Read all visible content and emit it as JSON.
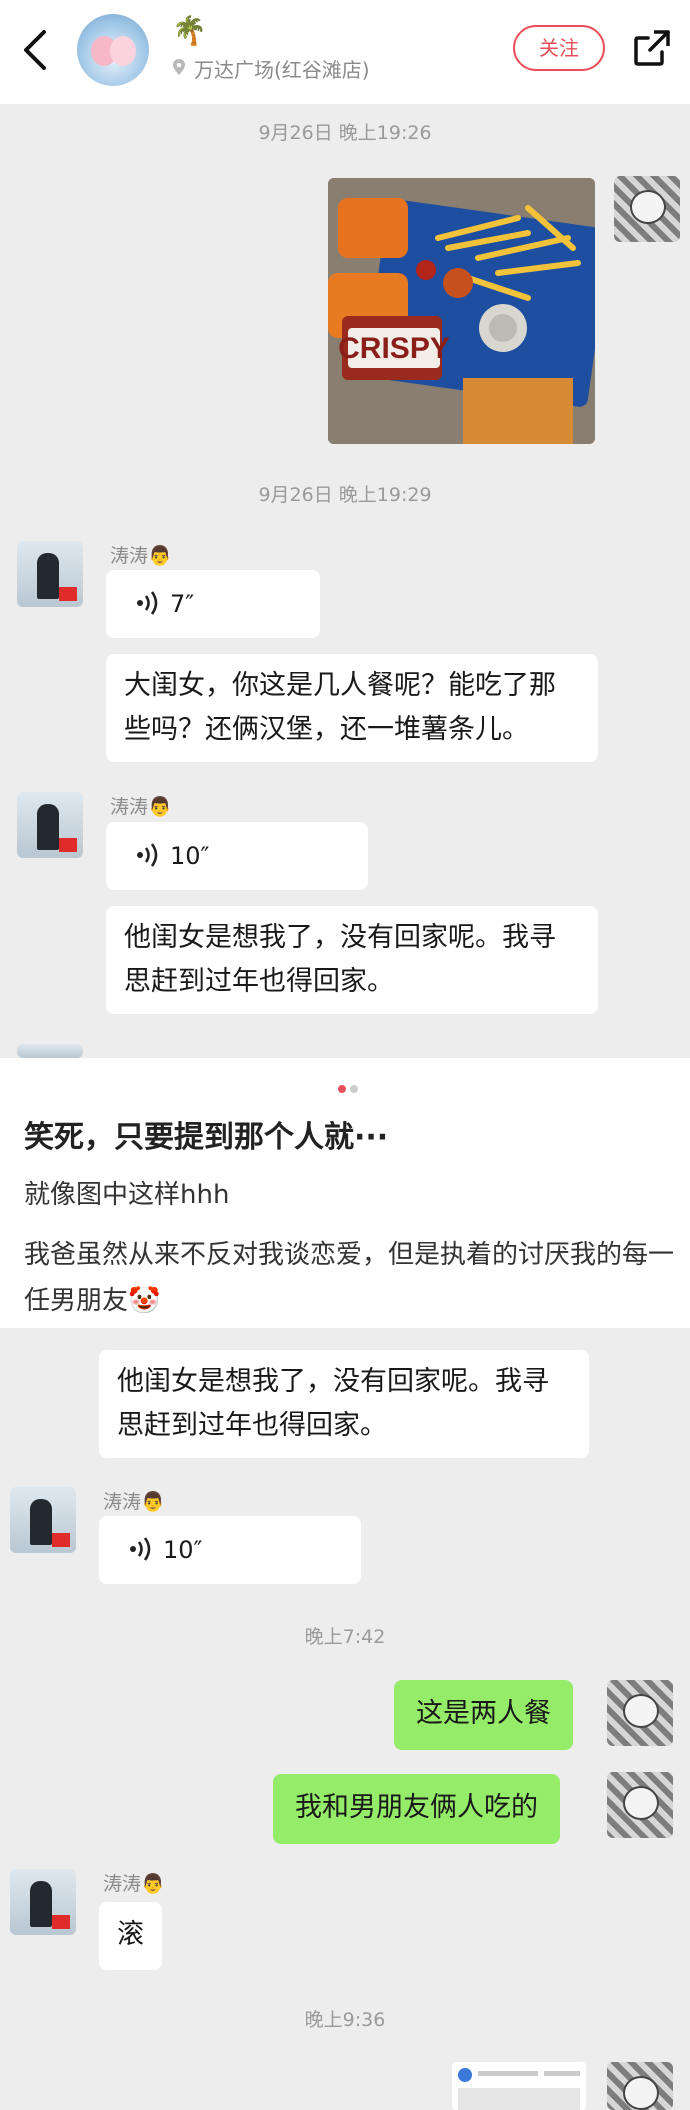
{
  "header": {
    "location": "万达广场(红谷滩店)",
    "follow_label": "关注",
    "palm_emoji": "🌴"
  },
  "timestamps": [
    "9月26日 晚上19:26",
    "9月26日 晚上19:29",
    "晚上7:42",
    "晚上9:36"
  ],
  "photo": {
    "label": "CRISPY"
  },
  "contact_name": "涛涛",
  "contact_emoji": "👨",
  "messages": {
    "voice_1": "7″",
    "text_1": "大闺女，你这是几人餐呢？能吃了那些吗？还俩汉堡，还一堆薯条儿。",
    "voice_2": "10″",
    "text_2": "他闺女是想我了，没有回家呢。我寻思赶到过年也得回家。",
    "text_3": "他闺女是想我了，没有回家呢。我寻思赶到过年也得回家。",
    "voice_3": "10″",
    "my_1": "这是两人餐",
    "my_2": "我和男朋友俩人吃的",
    "reply": "滚"
  },
  "note": {
    "title": "笑死，只要提到那个人就···",
    "line1": "就像图中这样hhh",
    "line2": "我爸虽然从来不反对我谈恋爱，但是执着的讨厌我的每一任男朋友🤡"
  },
  "colors": {
    "accent": "#e8505b",
    "my_bubble": "#95ec69",
    "background": "#ededed"
  }
}
